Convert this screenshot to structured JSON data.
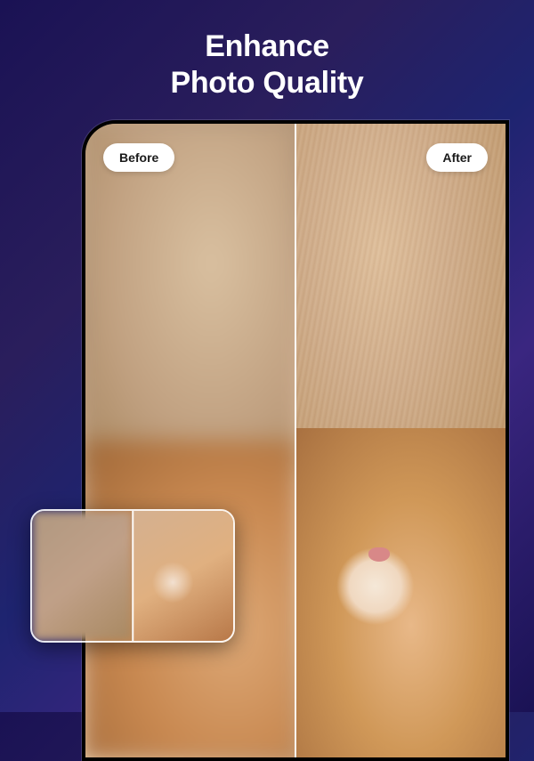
{
  "headline": {
    "line1": "Enhance",
    "line2": "Photo Quality"
  },
  "comparison": {
    "before_label": "Before",
    "after_label": "After"
  }
}
